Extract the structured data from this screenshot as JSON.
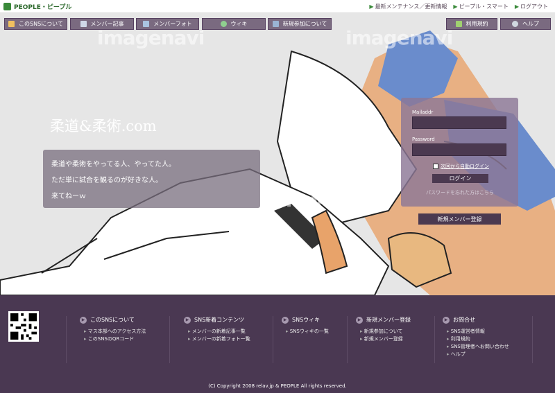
{
  "header": {
    "logo": "PEOPLE・ピープル",
    "links": [
      "最新メンテナンス／更新情報",
      "ピープル・スマート",
      "ログアウト"
    ]
  },
  "nav": {
    "left": [
      "このSNSについて",
      "メンバー記事",
      "メンバーフォト",
      "ウィキ",
      "新規参加について"
    ],
    "right": [
      "利用規約",
      "ヘルプ"
    ]
  },
  "watermark": "imagenavi",
  "hero": {
    "title": "柔道&柔術.com",
    "tagline": [
      "柔道や柔術をやってる人、やってた人。",
      "ただ単に試合を観るのが好きな人。",
      "来てねーｗ"
    ]
  },
  "login": {
    "mail_label": "Mailaddr",
    "password_label": "Password",
    "auto_login": "次回から自動ログイン",
    "login_button": "ログイン",
    "forgot": "パスワードを忘れた方はこちら",
    "register": "新規メンバー登録"
  },
  "footer": {
    "columns": [
      {
        "title": "このSNSについて",
        "items": [
          "マス本部へのアクセス方法",
          "このSNSのQRコード"
        ]
      },
      {
        "title": "SNS新着コンテンツ",
        "items": [
          "メンバーの新着記事一覧",
          "メンバーの新着フォト一覧"
        ]
      },
      {
        "title": "SNSウィキ",
        "items": [
          "SNSウィキの一覧"
        ]
      },
      {
        "title": "新規メンバー登録",
        "items": [
          "新規参加について",
          "新規メンバー登録"
        ]
      },
      {
        "title": "お問合せ",
        "items": [
          "SNS運営者情報",
          "利用規約",
          "SNS管理者へお問い合わせ",
          "ヘルプ"
        ]
      }
    ],
    "copyright": "(C) Copyright 2008 relav.jp & PEOPLE All rights reserved."
  },
  "colors": {
    "accent": "#4a3852",
    "nav": "#7a6a80",
    "green": "#3a8a3a"
  }
}
